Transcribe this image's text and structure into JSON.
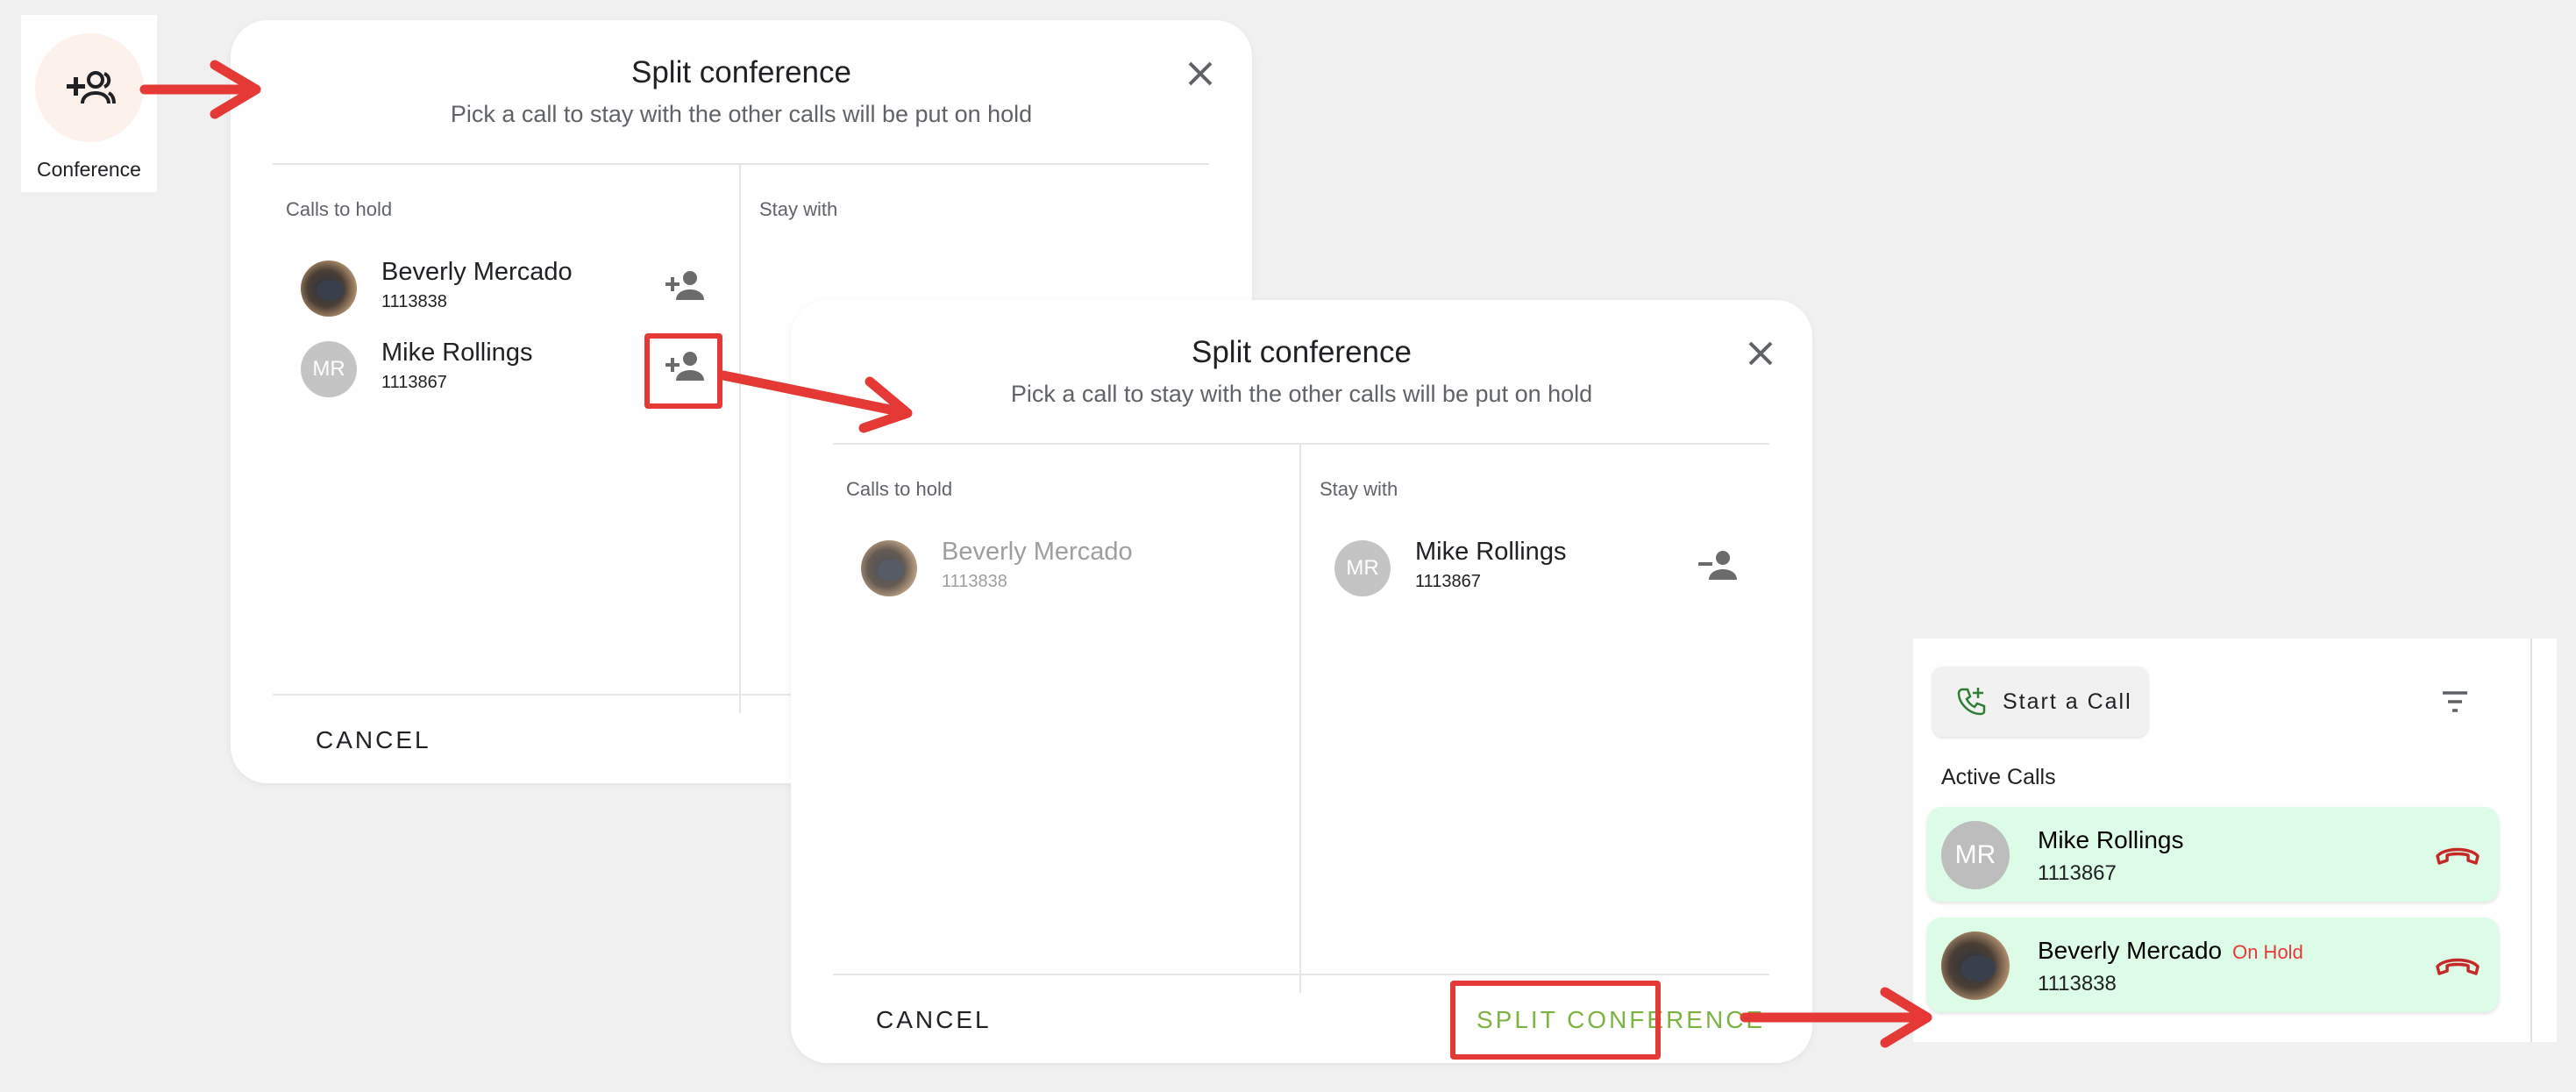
{
  "conference_tile": {
    "label": "Conference"
  },
  "dialog": {
    "title": "Split conference",
    "subtitle": "Pick a call to stay with the other calls will be put on hold",
    "calls_to_hold_label": "Calls to hold",
    "stay_with_label": "Stay with",
    "cancel_label": "CANCEL",
    "split_label": "SPLIT CONFERENCE"
  },
  "contacts": {
    "beverly": {
      "name": "Beverly Mercado",
      "number": "1113838"
    },
    "mike": {
      "name": "Mike Rollings",
      "number": "1113867",
      "initials": "MR"
    }
  },
  "calls_panel": {
    "start_call_label": "Start a Call",
    "section_title": "Active Calls",
    "calls": [
      {
        "name": "Mike Rollings",
        "number": "1113867",
        "initials": "MR",
        "status": ""
      },
      {
        "name": "Beverly Mercado",
        "number": "1113838",
        "status": "On Hold"
      }
    ]
  },
  "colors": {
    "accent_green": "#7cb342",
    "hangup_red": "#c62828",
    "on_hold_red": "#e53935",
    "arrow_red": "#e53935",
    "active_call_bg": "#dcfce7"
  },
  "icons": {
    "conference": "add-group-icon",
    "add_person": "person-add-icon",
    "remove_person": "person-remove-icon",
    "close": "close-icon",
    "phone_add": "phone-add-icon",
    "filter": "filter-icon",
    "hangup": "hangup-icon"
  }
}
